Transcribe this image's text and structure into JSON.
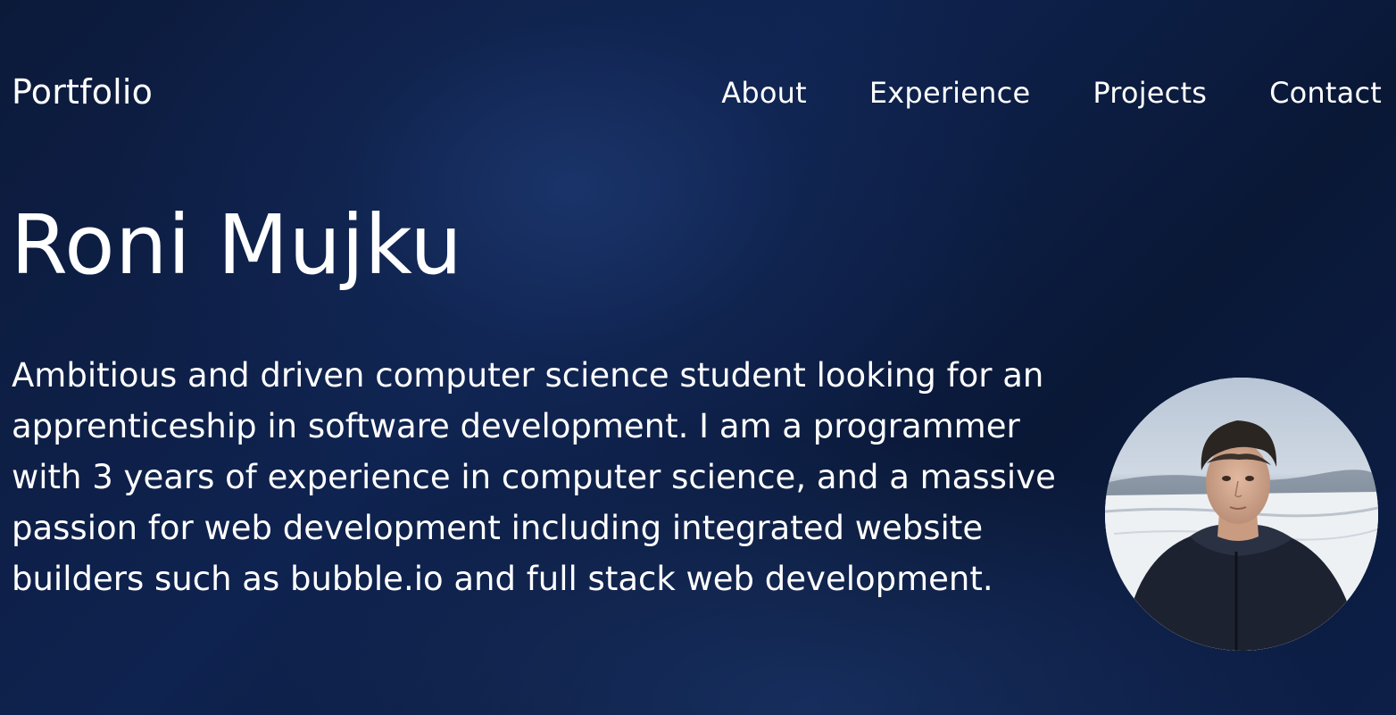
{
  "navbar": {
    "brand": "Portfolio",
    "links": [
      {
        "label": "About"
      },
      {
        "label": "Experience"
      },
      {
        "label": "Projects"
      },
      {
        "label": "Contact"
      }
    ]
  },
  "hero": {
    "name": "Roni Mujku",
    "bio": "Ambitious and driven computer science student looking for an apprenticeship in software development. I am a programmer with 3 years of experience in computer science, and a massive passion for web development including integrated website builders such as bubble.io and full stack web development."
  },
  "colors": {
    "background_dark": "#0b1a3c",
    "background_glow": "#1c376e",
    "text": "#ffffff"
  }
}
